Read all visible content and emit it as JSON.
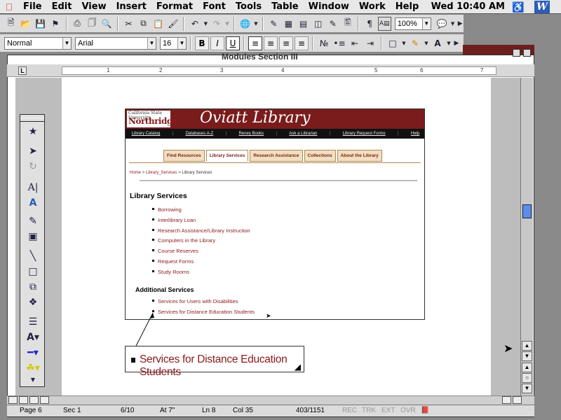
{
  "menubar": {
    "items": [
      "File",
      "Edit",
      "View",
      "Insert",
      "Format",
      "Font",
      "Tools",
      "Table",
      "Window",
      "Work",
      "Help"
    ],
    "clock": "Wed 10:40 AM",
    "app_icon": "W"
  },
  "toolbar": {
    "zoom": "100%"
  },
  "formatting": {
    "style": "Normal",
    "font": "Arial",
    "size": "16",
    "bold": "B",
    "italic": "I",
    "underline": "U"
  },
  "document": {
    "title": "Modules Section III",
    "ruler_numbers": [
      "1",
      "2",
      "3",
      "4",
      "5",
      "6",
      "7"
    ]
  },
  "palette": {
    "text_tool": "A|"
  },
  "webpage": {
    "logo_top": "California State University",
    "logo_main": "Northridge",
    "title": "Oviatt Library",
    "nav": [
      "Library Catalog",
      "Databases A-Z",
      "Reney Books",
      "Ask a Librarian",
      "Library Request Forms",
      "Help"
    ],
    "nav_sep": "|",
    "tabs": [
      "Find Resources",
      "Library Services",
      "Research Assistance",
      "Collections",
      "About the Library"
    ],
    "crumb_home": "Home",
    "crumb_mid": "Library_Services",
    "crumb_current": "Library Services",
    "crumb_sep": ">",
    "heading": "Library Services",
    "services": [
      "Borrowing",
      "Interlibrary Loan",
      "Research Assistance/Library Instruction",
      "Computers in the Library",
      "Course Reserves",
      "Request Forms",
      "Study Rooms"
    ],
    "additional_heading": "Additional Services",
    "additional": [
      "Services for Users with Disabilities",
      "Services for Distance Education Students"
    ]
  },
  "callout": {
    "text": "Services for Distance Education Students"
  },
  "status": {
    "page": "Page 6",
    "sec": "Sec 1",
    "pages": "6/10",
    "at": "At 7\"",
    "ln": "Ln 8",
    "col": "Col 35",
    "words": "403/1151",
    "rec": "REC",
    "trk": "TRK",
    "ext": "EXT",
    "ovr": "OVR"
  }
}
